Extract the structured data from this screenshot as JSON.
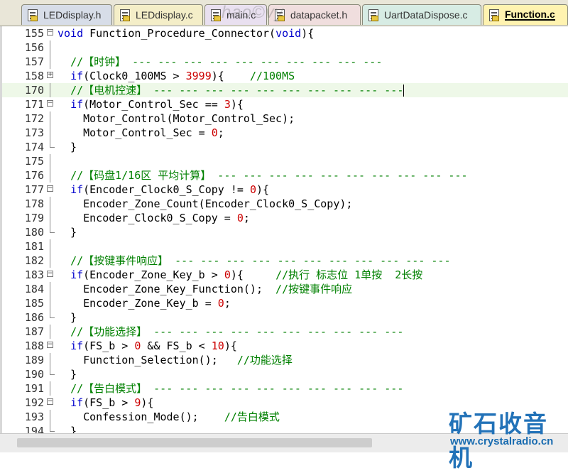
{
  "tabs": [
    {
      "label": "LEDdisplay.h",
      "active": false
    },
    {
      "label": "LEDdisplay.c",
      "active": false
    },
    {
      "label": "main.c",
      "active": false
    },
    {
      "label": "datapacket.h",
      "active": false
    },
    {
      "label": "UartDataDispose.c",
      "active": false
    },
    {
      "label": "Function.c",
      "active": true
    }
  ],
  "editor": {
    "lines": [
      {
        "num": "155",
        "fold": "minus",
        "code": [
          [
            "kw",
            "void"
          ],
          [
            "t",
            " Function_Procedure_Connector("
          ],
          [
            "kw",
            "void"
          ],
          [
            "t",
            "){"
          ]
        ]
      },
      {
        "num": "156",
        "fold": "line",
        "code": []
      },
      {
        "num": "157",
        "fold": "line",
        "code": [
          [
            "t",
            "  "
          ],
          [
            "cm",
            "//【时钟】 --- --- --- --- --- --- --- --- --- ---"
          ]
        ]
      },
      {
        "num": "158",
        "fold": "plus",
        "code": [
          [
            "t",
            "  "
          ],
          [
            "kw",
            "if"
          ],
          [
            "t",
            "(Clock0_100MS > "
          ],
          [
            "num",
            "3999"
          ],
          [
            "t",
            "){    "
          ],
          [
            "cm",
            "//100MS"
          ]
        ]
      },
      {
        "num": "170",
        "fold": "line",
        "highlight": true,
        "code": [
          [
            "t",
            "  "
          ],
          [
            "cm",
            "//【电机控速】 --- --- --- --- --- --- --- --- --- ---"
          ]
        ]
      },
      {
        "num": "171",
        "fold": "minus",
        "code": [
          [
            "t",
            "  "
          ],
          [
            "kw",
            "if"
          ],
          [
            "t",
            "(Motor_Control_Sec == "
          ],
          [
            "num",
            "3"
          ],
          [
            "t",
            "){"
          ]
        ]
      },
      {
        "num": "172",
        "fold": "line",
        "code": [
          [
            "t",
            "    Motor_Control(Motor_Control_Sec);"
          ]
        ]
      },
      {
        "num": "173",
        "fold": "line",
        "code": [
          [
            "t",
            "    Motor_Control_Sec = "
          ],
          [
            "num",
            "0"
          ],
          [
            "t",
            ";"
          ]
        ]
      },
      {
        "num": "174",
        "fold": "end",
        "code": [
          [
            "t",
            "  }"
          ]
        ]
      },
      {
        "num": "175",
        "fold": "line",
        "code": []
      },
      {
        "num": "176",
        "fold": "line",
        "code": [
          [
            "t",
            "  "
          ],
          [
            "cm",
            "//【码盘1/16区 平均计算】 --- --- --- --- --- --- --- --- --- ---"
          ]
        ]
      },
      {
        "num": "177",
        "fold": "minus",
        "code": [
          [
            "t",
            "  "
          ],
          [
            "kw",
            "if"
          ],
          [
            "t",
            "(Encoder_Clock0_S_Copy != "
          ],
          [
            "num",
            "0"
          ],
          [
            "t",
            "){"
          ]
        ]
      },
      {
        "num": "178",
        "fold": "line",
        "code": [
          [
            "t",
            "    Encoder_Zone_Count(Encoder_Clock0_S_Copy);"
          ]
        ]
      },
      {
        "num": "179",
        "fold": "line",
        "code": [
          [
            "t",
            "    Encoder_Clock0_S_Copy = "
          ],
          [
            "num",
            "0"
          ],
          [
            "t",
            ";"
          ]
        ]
      },
      {
        "num": "180",
        "fold": "end",
        "code": [
          [
            "t",
            "  }"
          ]
        ]
      },
      {
        "num": "181",
        "fold": "line",
        "code": []
      },
      {
        "num": "182",
        "fold": "line",
        "code": [
          [
            "t",
            "  "
          ],
          [
            "cm",
            "//【按键事件响应】 --- --- --- --- --- --- --- --- --- --- ---"
          ]
        ]
      },
      {
        "num": "183",
        "fold": "minus",
        "code": [
          [
            "t",
            "  "
          ],
          [
            "kw",
            "if"
          ],
          [
            "t",
            "(Encoder_Zone_Key_b > "
          ],
          [
            "num",
            "0"
          ],
          [
            "t",
            "){     "
          ],
          [
            "cm",
            "//执行 标志位 1单按  2长按"
          ]
        ]
      },
      {
        "num": "184",
        "fold": "line",
        "code": [
          [
            "t",
            "    Encoder_Zone_Key_Function();  "
          ],
          [
            "cm",
            "//按键事件响应"
          ]
        ]
      },
      {
        "num": "185",
        "fold": "line",
        "code": [
          [
            "t",
            "    Encoder_Zone_Key_b = "
          ],
          [
            "num",
            "0"
          ],
          [
            "t",
            ";"
          ]
        ]
      },
      {
        "num": "186",
        "fold": "end",
        "code": [
          [
            "t",
            "  }"
          ]
        ]
      },
      {
        "num": "187",
        "fold": "line",
        "code": [
          [
            "t",
            "  "
          ],
          [
            "cm",
            "//【功能选择】 --- --- --- --- --- --- --- --- --- ---"
          ]
        ]
      },
      {
        "num": "188",
        "fold": "minus",
        "code": [
          [
            "t",
            "  "
          ],
          [
            "kw",
            "if"
          ],
          [
            "t",
            "(FS_b > "
          ],
          [
            "num",
            "0"
          ],
          [
            "t",
            " && FS_b < "
          ],
          [
            "num",
            "10"
          ],
          [
            "t",
            "){"
          ]
        ]
      },
      {
        "num": "189",
        "fold": "line",
        "code": [
          [
            "t",
            "    Function_Selection();   "
          ],
          [
            "cm",
            "//功能选择"
          ]
        ]
      },
      {
        "num": "190",
        "fold": "end",
        "code": [
          [
            "t",
            "  }"
          ]
        ]
      },
      {
        "num": "191",
        "fold": "line",
        "code": [
          [
            "t",
            "  "
          ],
          [
            "cm",
            "//【告白模式】 --- --- --- --- --- --- --- --- --- ---"
          ]
        ]
      },
      {
        "num": "192",
        "fold": "minus",
        "code": [
          [
            "t",
            "  "
          ],
          [
            "kw",
            "if"
          ],
          [
            "t",
            "(FS_b > "
          ],
          [
            "num",
            "9"
          ],
          [
            "t",
            "){"
          ]
        ]
      },
      {
        "num": "193",
        "fold": "line",
        "code": [
          [
            "t",
            "    Confession_Mode();    "
          ],
          [
            "cm",
            "//告白模式"
          ]
        ]
      },
      {
        "num": "194",
        "fold": "end",
        "code": [
          [
            "t",
            "  }"
          ]
        ]
      }
    ]
  },
  "watermark": {
    "top_text": "hao©vy",
    "logo_text": "矿石收音机",
    "url_text": "www.crystalradio.cn"
  },
  "colors": {
    "keyword": "#0000cc",
    "number": "#cc0000",
    "comment": "#008000",
    "tabbar": "#e9e6d8"
  }
}
